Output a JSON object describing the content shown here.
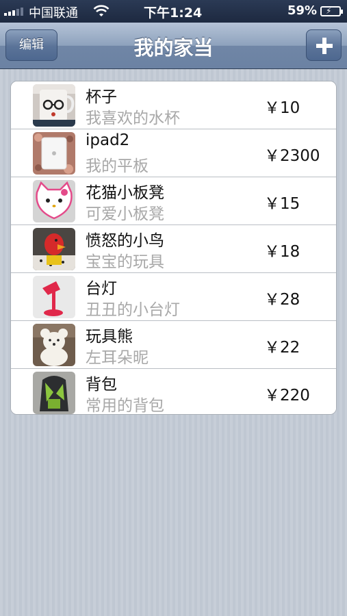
{
  "status_bar": {
    "carrier": "中国联通",
    "time": "下午1:24",
    "battery": "59%"
  },
  "nav": {
    "title": "我的家当",
    "edit_label": "编辑",
    "add_icon": "plus-icon"
  },
  "items": [
    {
      "name": "杯子",
      "desc": "我喜欢的水杯",
      "price": "￥10",
      "thumb": "mug-photo"
    },
    {
      "name": "ipad2",
      "desc": "我的平板",
      "price": "￥2300",
      "thumb": "ipad-photo"
    },
    {
      "name": "花猫小板凳",
      "desc": "可爱小板凳",
      "price": "￥15",
      "thumb": "cat-stool-photo"
    },
    {
      "name": "愤怒的小鸟",
      "desc": "宝宝的玩具",
      "price": "￥18",
      "thumb": "angry-bird-photo"
    },
    {
      "name": "台灯",
      "desc": "丑丑的小台灯",
      "price": "￥28",
      "thumb": "desk-lamp-photo"
    },
    {
      "name": "玩具熊",
      "desc": "左耳朵昵",
      "price": "￥22",
      "thumb": "teddy-bear-photo"
    },
    {
      "name": "背包",
      "desc": "常用的背包",
      "price": "￥220",
      "thumb": "backpack-photo"
    }
  ],
  "colors": {
    "nav_top": "#b5c3d7",
    "nav_bottom": "#6b82a3",
    "subtitle": "#a8a8a8",
    "background": "#c5ccd6"
  }
}
